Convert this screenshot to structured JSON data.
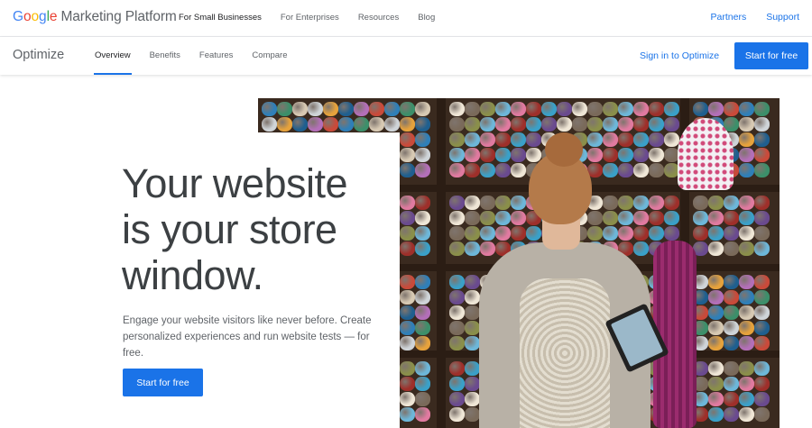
{
  "header": {
    "logo_google": "Google",
    "logo_platform": "Marketing Platform",
    "nav": [
      {
        "label": "For Small Businesses"
      },
      {
        "label": "For Enterprises"
      },
      {
        "label": "Resources"
      },
      {
        "label": "Blog"
      }
    ],
    "links": [
      {
        "label": "Partners"
      },
      {
        "label": "Support"
      }
    ]
  },
  "subheader": {
    "product": "Optimize",
    "tabs": [
      {
        "label": "Overview",
        "active": true
      },
      {
        "label": "Benefits"
      },
      {
        "label": "Features"
      },
      {
        "label": "Compare"
      }
    ],
    "sign_in": "Sign in to Optimize",
    "cta": "Start for free"
  },
  "hero": {
    "headline_line1": "Your website",
    "headline_line2": "is your store",
    "headline_line3": "window.",
    "subtext": "Engage your website visitors like never before. Create personalized experiences and run website tests — for free.",
    "cta": "Start for free",
    "image_alt": "hero-image-yarn-store"
  },
  "colors": {
    "accent": "#1a73e8",
    "google_blue": "#4285f4",
    "google_red": "#ea4335",
    "google_yellow": "#fbbc05",
    "google_green": "#34a853"
  }
}
